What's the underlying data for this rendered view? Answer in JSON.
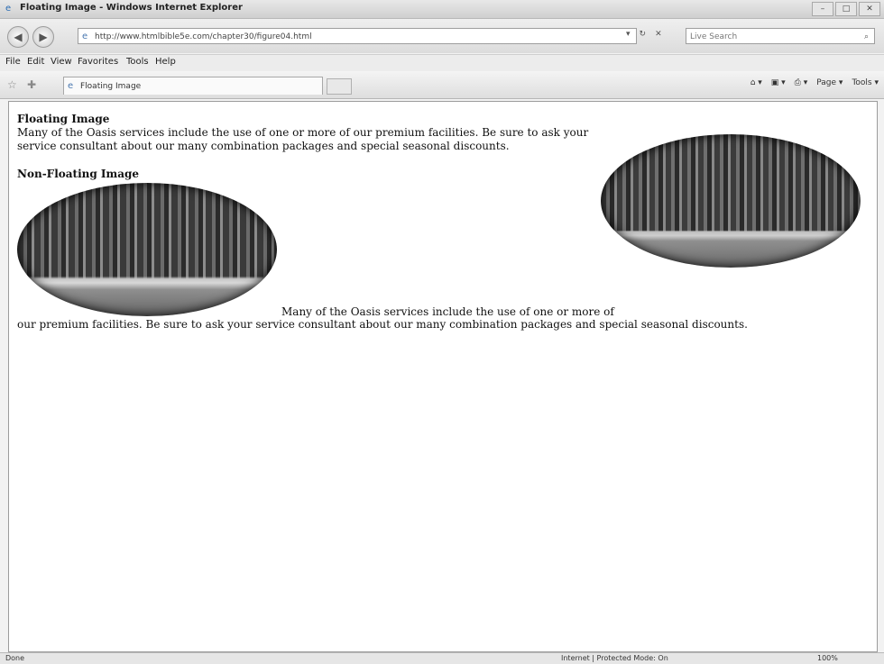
{
  "window": {
    "title": "Floating Image - Windows Internet Explorer",
    "controls": [
      "–",
      "□",
      "✕"
    ]
  },
  "address_bar": {
    "url": "http://www.htmlbible5e.com/chapter30/figure04.html",
    "refresh_label": "↻",
    "stop_label": "✕",
    "go_dropdown": "▾"
  },
  "search": {
    "placeholder": "Live Search"
  },
  "menu": {
    "items": [
      "File",
      "Edit",
      "View",
      "Favorites",
      "Tools",
      "Help"
    ]
  },
  "tab": {
    "label": "Floating Image"
  },
  "command_bar": {
    "page_label": "Page ▾",
    "tools_label": "Tools ▾"
  },
  "content": {
    "heading1": "Floating Image",
    "para1": "Many of the Oasis services include the use of one or more of our premium facilities. Be sure to ask your service consultant about our many combination packages and special seasonal discounts.",
    "heading2": "Non-Floating Image",
    "para2_line1": "Many of the Oasis services include the use of one or more of",
    "para2_line2": "our premium facilities. Be sure to ask your service consultant about our many combination packages and special seasonal discounts."
  },
  "status_bar": {
    "left": "Done",
    "zone": "Internet | Protected Mode: On",
    "zoom": "100%"
  },
  "icons": {
    "back": "back-arrow-icon",
    "forward": "forward-arrow-icon",
    "page": "page-icon",
    "search": "search-icon",
    "favorites": "star-icon",
    "add_favorite": "add-favorite-icon",
    "home": "home-icon",
    "feeds": "feeds-icon",
    "print": "printer-icon"
  }
}
